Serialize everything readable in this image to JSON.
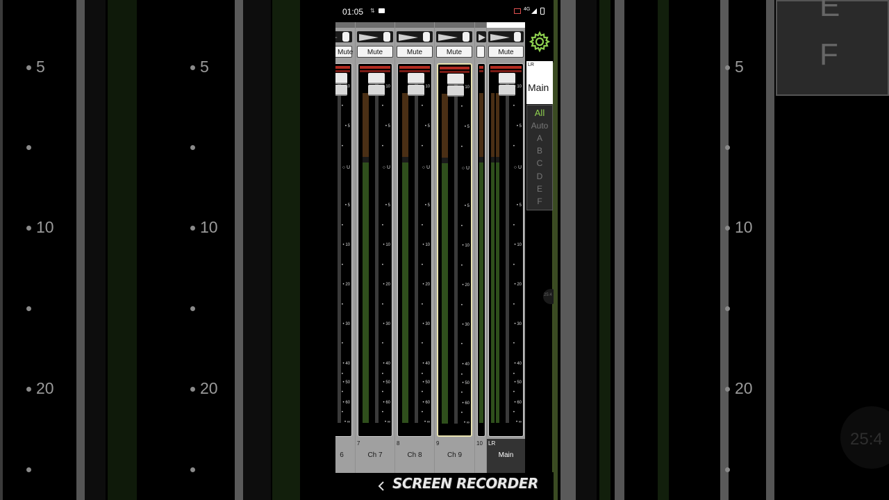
{
  "status_bar": {
    "time": "01:05",
    "network": "4G"
  },
  "background": {
    "scale_labels": [
      "5",
      "10",
      "20"
    ],
    "right_letters": [
      "E",
      "F"
    ],
    "timer": "25:4"
  },
  "channels": [
    {
      "number": "",
      "name": "6",
      "mute_label": "Mute"
    },
    {
      "number": "7",
      "name": "Ch 7",
      "mute_label": "Mute"
    },
    {
      "number": "8",
      "name": "Ch 8",
      "mute_label": "Mute"
    },
    {
      "number": "9",
      "name": "Ch 9",
      "mute_label": "Mute"
    },
    {
      "number": "10",
      "name": "",
      "mute_label": ""
    },
    {
      "number": "LR",
      "name": "Main",
      "mute_label": "Mute"
    }
  ],
  "fader_scale": [
    "10",
    "5",
    "U",
    "5",
    "10",
    "20",
    "30",
    "40",
    "50",
    "60",
    "∞"
  ],
  "right_panel": {
    "settings_icon": "gear-icon",
    "bus_tag": "LR",
    "bus_name": "Main",
    "groups": [
      "All",
      "Auto",
      "A",
      "B",
      "C",
      "D",
      "E",
      "F"
    ],
    "selected_group": "All",
    "mini_timer": "25:4"
  },
  "watermark": "SCREEN RECORDER",
  "nav": {
    "back_icon": "chevron-left-icon"
  },
  "colors": {
    "accent_green": "#8fd14f",
    "meter_green": "#2f4f1c",
    "meter_orange": "#4a2f15",
    "clip_red": "#b22a20"
  }
}
